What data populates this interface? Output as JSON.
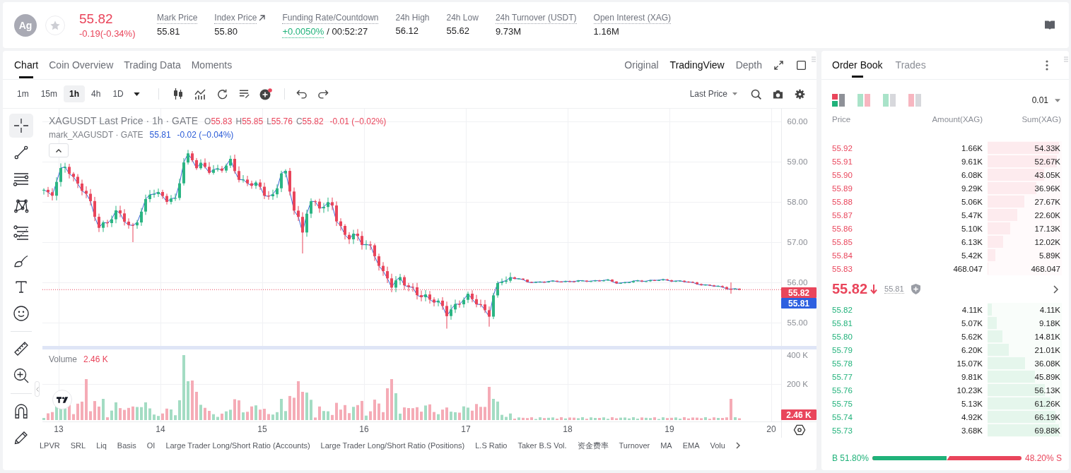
{
  "ticker": {
    "symbol": "Ag",
    "favorite": false,
    "price": "55.82",
    "change": "-0.19(-0.34%)",
    "falling": true
  },
  "stats": [
    {
      "label": "Mark Price",
      "value": "55.81",
      "tooltip": true,
      "link": false,
      "positive": false
    },
    {
      "label": "Index Price",
      "value": "55.80",
      "tooltip": true,
      "link": true,
      "positive": false
    },
    {
      "label": "Funding Rate/Countdown",
      "value": "+0.0050%",
      "suffix": "/ 00:52:27",
      "tooltip": true,
      "link": false,
      "positive": true
    },
    {
      "label": "24h High",
      "value": "56.12",
      "tooltip": false,
      "link": false,
      "positive": false
    },
    {
      "label": "24h Low",
      "value": "55.62",
      "tooltip": false,
      "link": false,
      "positive": false
    },
    {
      "label": "24h Turnover (USDT)",
      "value": "9.73M",
      "tooltip": true,
      "link": false,
      "positive": false
    },
    {
      "label": "Open Interest (XAG)",
      "value": "1.16M",
      "tooltip": true,
      "link": false,
      "positive": false
    }
  ],
  "chart_panel": {
    "tabs": [
      {
        "label": "Chart",
        "selected": true
      },
      {
        "label": "Coin Overview",
        "selected": false
      },
      {
        "label": "Trading Data",
        "selected": false
      },
      {
        "label": "Moments",
        "selected": false
      }
    ],
    "views": [
      {
        "label": "Original",
        "selected": false
      },
      {
        "label": "TradingView",
        "selected": true
      },
      {
        "label": "Depth",
        "selected": false
      }
    ],
    "intervals": [
      {
        "label": "1m",
        "selected": false
      },
      {
        "label": "15m",
        "selected": false
      },
      {
        "label": "1h",
        "selected": true
      },
      {
        "label": "4h",
        "selected": false
      },
      {
        "label": "1D",
        "selected": false
      }
    ],
    "price_source": "Last Price",
    "tool_groups": [
      [
        {
          "kind": "crosshair",
          "selected": true
        },
        {
          "kind": "trend-line",
          "selected": false
        },
        {
          "kind": "parallel-lines",
          "selected": false
        },
        {
          "kind": "pattern",
          "selected": false
        },
        {
          "kind": "fib-channel",
          "selected": false
        },
        {
          "kind": "brush",
          "selected": false
        },
        {
          "kind": "text",
          "selected": false
        },
        {
          "kind": "emoji",
          "selected": false
        }
      ],
      [
        {
          "kind": "ruler",
          "selected": false
        },
        {
          "kind": "zoom",
          "selected": false
        }
      ],
      [
        {
          "kind": "magnet",
          "selected": false
        },
        {
          "kind": "pencil",
          "selected": false
        }
      ]
    ],
    "legend": {
      "title": "XAGUSDT Last Price · 1h · GATE",
      "ohlc": [
        {
          "key": "O",
          "value": "55.83"
        },
        {
          "key": "H",
          "value": "55.85"
        },
        {
          "key": "L",
          "value": "55.76"
        },
        {
          "key": "C",
          "value": "55.82"
        }
      ],
      "change": "-0.01 (−0.02%)",
      "falling": true
    },
    "mark_legend": {
      "title": "mark_XAGUSDT · GATE",
      "value": "55.81",
      "change": "-0.02 (−0.04%)"
    },
    "price_axis": [
      "60.00",
      "59.00",
      "58.00",
      "57.00",
      "56.00",
      "55.00"
    ],
    "last_price_tag": "55.82",
    "mark_price_tag": "55.81",
    "volume_legend": {
      "title": "Volume",
      "value": "2.46 K"
    },
    "volume_axis": [
      "400 K",
      "200 K"
    ],
    "volume_tag": "2.46 K",
    "time_axis": [
      "13",
      "14",
      "15",
      "16",
      "17",
      "18",
      "19",
      "20"
    ],
    "indicators": [
      "LPVR",
      "SRL",
      "Liq",
      "Basis",
      "OI",
      "Large Trader Long/Short Ratio (Accounts)",
      "Large Trader Long/Short Ratio (Positions)",
      "L.S Ratio",
      "Taker B.S Vol.",
      "资金费率",
      "Turnover",
      "MA",
      "EMA",
      "Volu"
    ]
  },
  "order_book": {
    "tabs": [
      {
        "label": "Order Book",
        "selected": true
      },
      {
        "label": "Trades",
        "selected": false
      }
    ],
    "views": [
      {
        "kind": "both",
        "selected": true
      },
      {
        "kind": "split",
        "selected": false
      },
      {
        "kind": "bids",
        "selected": false
      },
      {
        "kind": "asks",
        "selected": false
      }
    ],
    "precision": "0.01",
    "columns": [
      "Price",
      "Amount(XAG)",
      "Sum(XAG)"
    ],
    "asks": [
      {
        "price": "55.92",
        "amount": "1.66K",
        "sum": "54.33K",
        "level": 1.0
      },
      {
        "price": "55.91",
        "amount": "9.61K",
        "sum": "52.67K",
        "level": 0.97
      },
      {
        "price": "55.90",
        "amount": "6.08K",
        "sum": "43.05K",
        "level": 0.79
      },
      {
        "price": "55.89",
        "amount": "9.29K",
        "sum": "36.96K",
        "level": 0.68
      },
      {
        "price": "55.88",
        "amount": "5.06K",
        "sum": "27.67K",
        "level": 0.51
      },
      {
        "price": "55.87",
        "amount": "5.47K",
        "sum": "22.60K",
        "level": 0.42
      },
      {
        "price": "55.86",
        "amount": "5.10K",
        "sum": "17.13K",
        "level": 0.32
      },
      {
        "price": "55.85",
        "amount": "6.13K",
        "sum": "12.02K",
        "level": 0.22
      },
      {
        "price": "55.84",
        "amount": "5.42K",
        "sum": "5.89K",
        "level": 0.11
      },
      {
        "price": "55.83",
        "amount": "468.047",
        "sum": "468.047",
        "level": 0.01
      }
    ],
    "last": {
      "price": "55.82",
      "falling": true,
      "mark": "55.81"
    },
    "bids": [
      {
        "price": "55.82",
        "amount": "4.11K",
        "sum": "4.11K",
        "level": 0.06
      },
      {
        "price": "55.81",
        "amount": "5.07K",
        "sum": "9.18K",
        "level": 0.13
      },
      {
        "price": "55.80",
        "amount": "5.62K",
        "sum": "14.81K",
        "level": 0.21
      },
      {
        "price": "55.79",
        "amount": "6.20K",
        "sum": "21.01K",
        "level": 0.3
      },
      {
        "price": "55.78",
        "amount": "15.07K",
        "sum": "36.08K",
        "level": 0.52
      },
      {
        "price": "55.77",
        "amount": "9.81K",
        "sum": "45.89K",
        "level": 0.66
      },
      {
        "price": "55.76",
        "amount": "10.23K",
        "sum": "56.13K",
        "level": 0.8
      },
      {
        "price": "55.75",
        "amount": "5.13K",
        "sum": "61.26K",
        "level": 0.88
      },
      {
        "price": "55.74",
        "amount": "4.92K",
        "sum": "66.19K",
        "level": 0.95
      },
      {
        "price": "55.73",
        "amount": "3.68K",
        "sum": "69.88K",
        "level": 1.0
      }
    ],
    "ratio": {
      "buy": "B 51.80%",
      "sell": "48.20% S",
      "level": 0.518
    }
  }
}
